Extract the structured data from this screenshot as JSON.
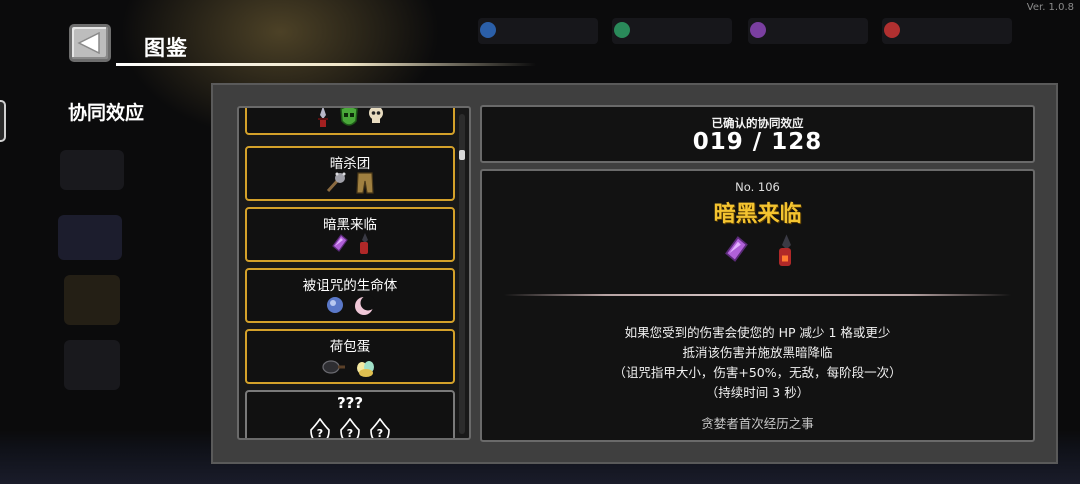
{
  "version": "Ver. 1.0.8",
  "header": {
    "title": "图鉴"
  },
  "section": {
    "label": "协同效应"
  },
  "synergy_list": {
    "items": [
      {
        "name": "",
        "icons": [
          "red-dagger-icon",
          "green-skull-mask-icon",
          "bone-skull-icon"
        ]
      },
      {
        "name": "暗杀团",
        "icons": [
          "spiked-club-icon",
          "leather-pants-icon"
        ]
      },
      {
        "name": "暗黑来临",
        "icons": [
          "purple-crystal-icon",
          "red-dagger-icon"
        ]
      },
      {
        "name": "被诅咒的生命体",
        "icons": [
          "blue-orb-icon",
          "crescent-moon-icon"
        ]
      },
      {
        "name": "荷包蛋",
        "icons": [
          "frying-pan-icon",
          "egg-bundle-icon"
        ]
      },
      {
        "name": "???",
        "icons": [
          "unknown-icon",
          "unknown-icon",
          "unknown-icon"
        ]
      }
    ],
    "unknown_mark": "?"
  },
  "counter": {
    "label": "已确认的协同效应",
    "value": "019 / 128"
  },
  "detail": {
    "number": "No. 106",
    "name": "暗黑来临",
    "icons": [
      "purple-crystal-icon",
      "red-dagger-icon"
    ],
    "description": [
      "如果您受到的伤害会使您的 HP 减少 1 格或更少",
      "抵消该伤害并施放黑暗降临",
      "（诅咒指甲大小，伤害+50%，无敌，每阶段一次）",
      "（持续时间 3 秒）"
    ],
    "source": "贪婪者首次经历之事"
  },
  "colors": {
    "accent_gold": "#f4c430",
    "card_border": "#d4a12a",
    "panel": "#3f3f3f"
  }
}
